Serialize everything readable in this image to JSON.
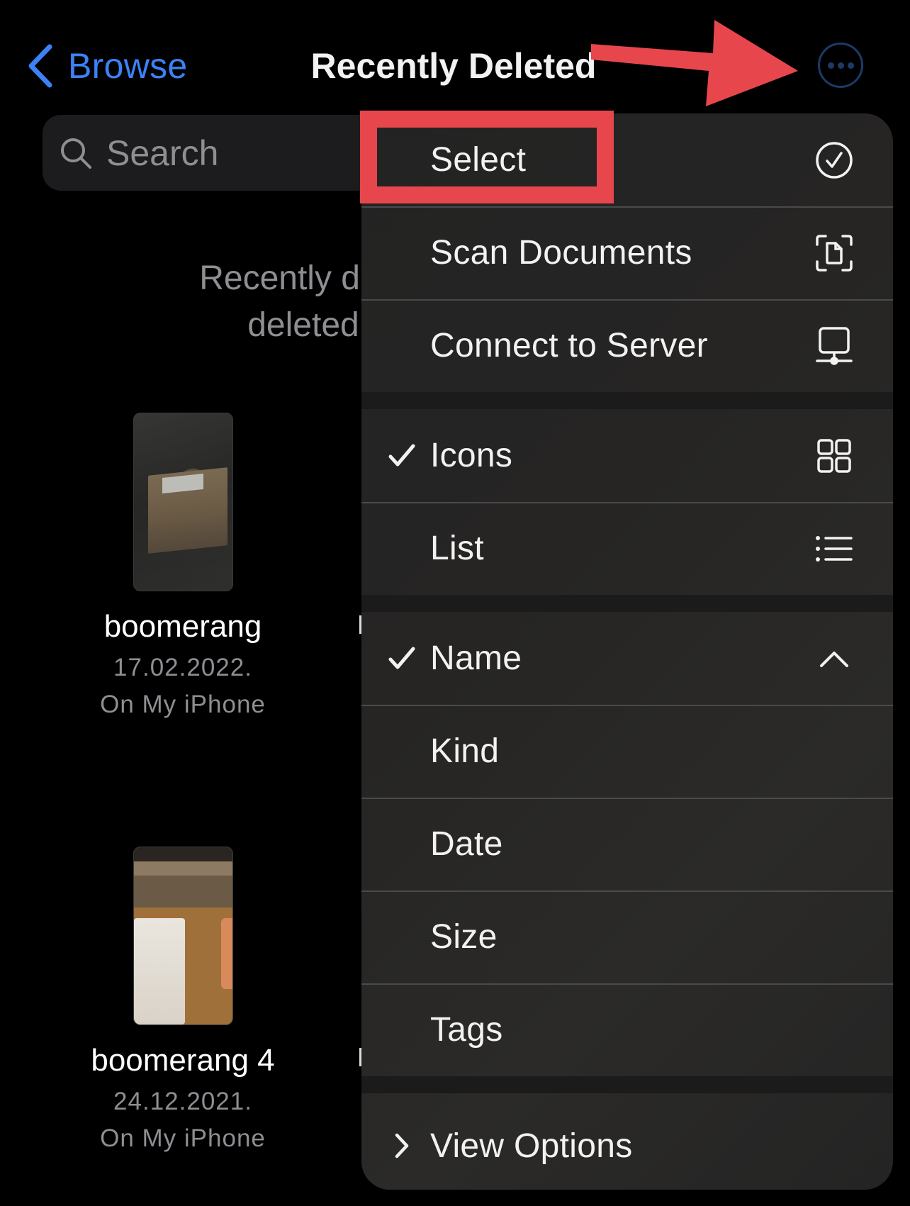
{
  "nav": {
    "back_label": "Browse",
    "title": "Recently Deleted",
    "more_icon": "ellipsis-circle-icon"
  },
  "search": {
    "placeholder": "Search",
    "value": ""
  },
  "info_message": {
    "line1": "Recently deleted",
    "line2": "deleted by"
  },
  "files": [
    {
      "name": "boomerang",
      "date": "17.02.2022.",
      "location": "On My iPhone"
    },
    {
      "name": "boomerang 4",
      "date": "24.12.2021.",
      "location": "On My iPhone"
    }
  ],
  "menu": {
    "actions": [
      {
        "label": "Select",
        "icon": "checkmark-circle-icon"
      },
      {
        "label": "Scan Documents",
        "icon": "doc-viewfinder-icon"
      },
      {
        "label": "Connect to Server",
        "icon": "server-display-icon"
      }
    ],
    "view_modes": [
      {
        "label": "Icons",
        "checked": true,
        "icon": "square-grid-icon"
      },
      {
        "label": "List",
        "checked": false,
        "icon": "list-bullet-icon"
      }
    ],
    "sort_by": [
      {
        "label": "Name",
        "checked": true,
        "icon": "chevron-up-icon"
      },
      {
        "label": "Kind",
        "checked": false
      },
      {
        "label": "Date",
        "checked": false
      },
      {
        "label": "Size",
        "checked": false
      },
      {
        "label": "Tags",
        "checked": false
      }
    ],
    "view_options": {
      "label": "View Options",
      "icon": "chevron-right-icon"
    }
  },
  "annotation": {
    "highlight_color": "#e8464d",
    "highlighted_item": "Select"
  },
  "colors": {
    "accent": "#3b82f6",
    "secondary_text": "#8e8e93",
    "menu_bg": "#232323"
  }
}
